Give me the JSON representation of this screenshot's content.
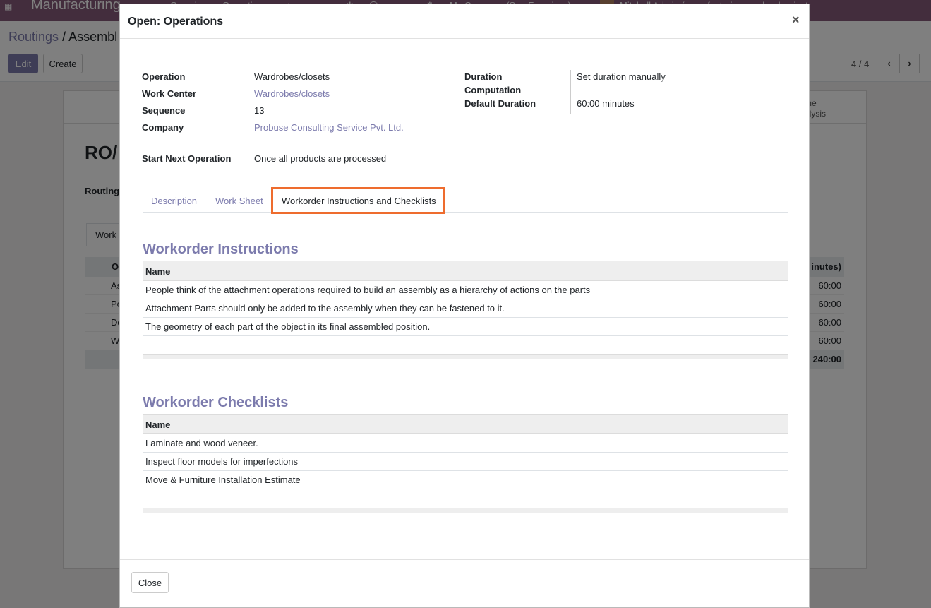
{
  "navbar": {
    "app_name": "Manufacturing",
    "menu_overview": "Overview",
    "menu_operations": "Operations",
    "company": "My Company (San Francisco)",
    "user": "Mitchell Admin (manufacturing_workorder_instr"
  },
  "control_panel": {
    "breadcrumb_root": "Routings",
    "breadcrumb_sep": "/",
    "breadcrumb_current": "Assembl",
    "edit_label": "Edit",
    "create_label": "Create",
    "pager": "4 / 4"
  },
  "background_form": {
    "statusbar_text_1": "me",
    "statusbar_text_2": "alysis",
    "title": "RO/",
    "routing_label": "Routing",
    "tab_label": "Work",
    "col_first": "O",
    "col_last": "inutes)",
    "rows": [
      {
        "c1": "As",
        "c2": "60:00"
      },
      {
        "c1": "Pc",
        "c2": "60:00"
      },
      {
        "c1": "Dc",
        "c2": "60:00"
      },
      {
        "c1": "W",
        "c2": "60:00"
      }
    ],
    "total": "240:00"
  },
  "modal": {
    "title": "Open: Operations",
    "close_x": "×",
    "fields": {
      "operation_label": "Operation",
      "operation_value": "Wardrobes/closets",
      "work_center_label": "Work Center",
      "work_center_value": "Wardrobes/closets",
      "sequence_label": "Sequence",
      "sequence_value": "13",
      "company_label": "Company",
      "company_value": "Probuse Consulting Service Pvt. Ltd.",
      "duration_label_1": "Duration",
      "duration_label_2": "Computation",
      "duration_value": "Set duration manually",
      "default_duration_label": "Default Duration",
      "default_duration_value": "60:00 minutes",
      "start_next_label": "Start Next Operation",
      "start_next_value": "Once all products are processed"
    },
    "tabs": [
      {
        "label": "Description"
      },
      {
        "label": "Work Sheet"
      },
      {
        "label": "Workorder Instructions and Checklists"
      }
    ],
    "instructions": {
      "title": "Workorder Instructions",
      "column": "Name",
      "rows": [
        "People think of the attachment operations required to build an assembly as a hierarchy of actions on the parts",
        "Attachment Parts should only be added to the assembly when they can be fastened to it.",
        "The geometry of each part of the object in its final assembled position."
      ]
    },
    "checklists": {
      "title": "Workorder Checklists",
      "column": "Name",
      "rows": [
        "Laminate and wood veneer.",
        "Inspect floor models for imperfections",
        "Move & Furniture Installation Estimate"
      ]
    },
    "close_button": "Close"
  },
  "colors": {
    "brand": "#875a7b",
    "link": "#7c7bad",
    "highlight": "#ee6c2e"
  }
}
